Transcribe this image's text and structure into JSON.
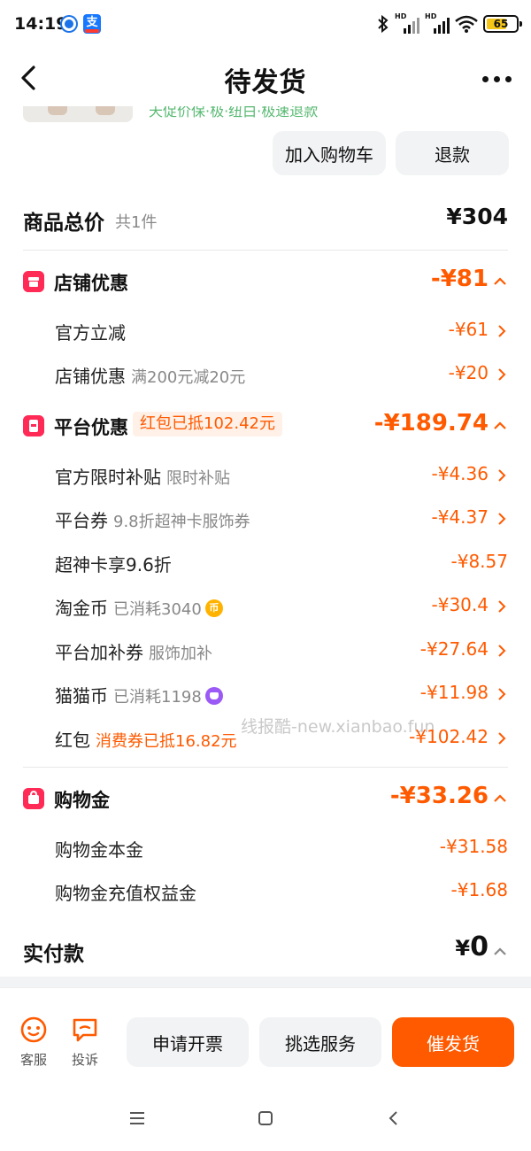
{
  "status_bar": {
    "time": "14:19",
    "battery": "65",
    "hd1": "HD",
    "hd2": "HD"
  },
  "nav": {
    "title": "待发货"
  },
  "product_peek": {
    "text": "天促价保·极·纽白·极速退款"
  },
  "actions": {
    "add_to_cart": "加入购物车",
    "refund": "退款"
  },
  "summary": {
    "label": "商品总价",
    "count": "共1件",
    "value": "¥304"
  },
  "store_discount": {
    "title": "店铺优惠",
    "amount": "-¥81",
    "rows": [
      {
        "label": "官方立减",
        "sub": "",
        "amount": "-¥61"
      },
      {
        "label": "店铺优惠",
        "sub": "满200元减20元",
        "amount": "-¥20"
      }
    ]
  },
  "platform_discount": {
    "title": "平台优惠",
    "tag": "红包已抵102.42元",
    "amount": "-¥189.74",
    "rows": [
      {
        "label": "官方限时补贴",
        "sub": "限时补贴",
        "amount": "-¥4.36"
      },
      {
        "label": "平台券",
        "sub": "9.8折超神卡服饰券",
        "amount": "-¥4.37"
      },
      {
        "label": "超神卡享9.6折",
        "sub": "",
        "amount": "-¥8.57"
      },
      {
        "label": "淘金币",
        "sub": "已消耗3040",
        "amount": "-¥30.4"
      },
      {
        "label": "平台加补券",
        "sub": "服饰加补",
        "amount": "-¥27.64"
      },
      {
        "label": "猫猫币",
        "sub": "已消耗1198",
        "amount": "-¥11.98"
      },
      {
        "label": "红包",
        "sub": "消费券已抵16.82元",
        "amount": "-¥102.42"
      }
    ]
  },
  "shopping_gold": {
    "title": "购物金",
    "amount": "-¥33.26",
    "rows": [
      {
        "label": "购物金本金",
        "amount": "-¥31.58"
      },
      {
        "label": "购物金充值权益金",
        "amount": "-¥1.68"
      }
    ]
  },
  "watermark": "线报酷-new.xianbao.fun",
  "payment": {
    "label": "实付款",
    "yen": "¥",
    "value": "0"
  },
  "bottom_bar": {
    "service": "客服",
    "complain": "投诉",
    "invoice": "申请开票",
    "pick_service": "挑选服务",
    "urge": "催发货"
  },
  "colors": {
    "accent": "#ff5a00",
    "section_icon": "#ff2a55",
    "button_gray": "#f2f3f5"
  }
}
